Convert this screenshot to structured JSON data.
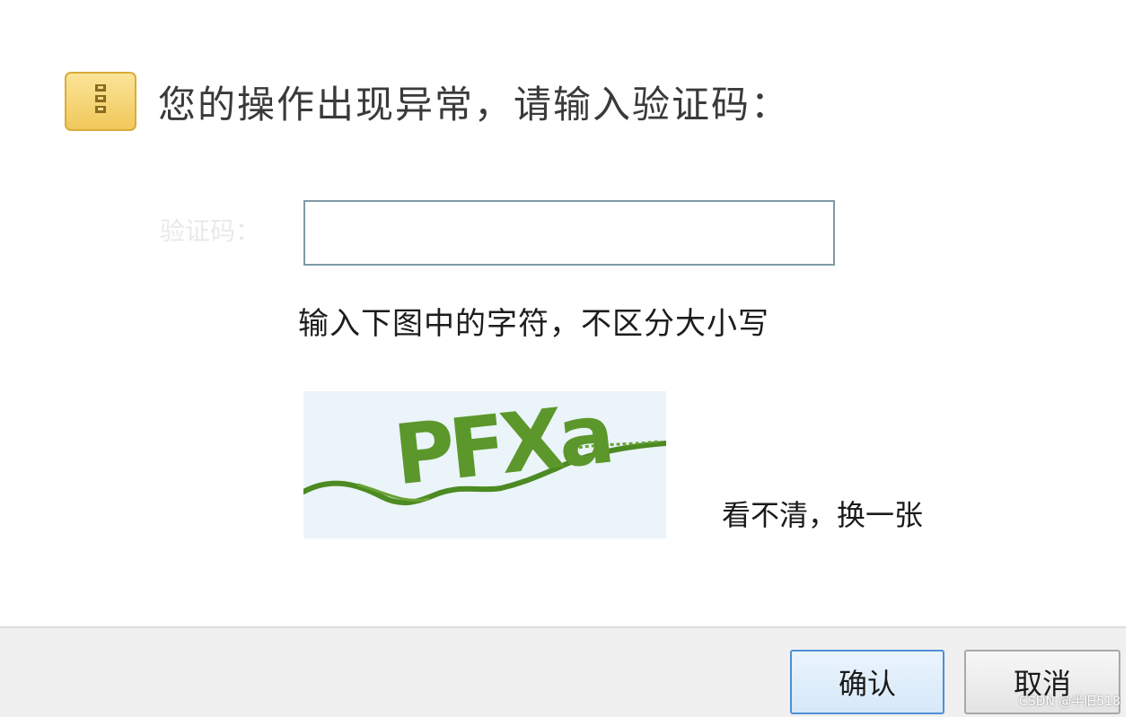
{
  "header": {
    "icon": "archive-icon",
    "title": "您的操作出现异常，请输入验证码："
  },
  "form": {
    "code_label": "验证码：",
    "input_value": "",
    "input_placeholder": "",
    "hint": "输入下图中的字符，不区分大小写"
  },
  "captcha": {
    "text": "PFXa",
    "refresh_label": "看不清，换一张"
  },
  "buttons": {
    "ok_label": "确认",
    "cancel_label": "取消"
  },
  "watermark": "CSDN @半旧518",
  "colors": {
    "captcha_green": "#5c972b",
    "captcha_bg": "#eaf4f9",
    "icon_yellow": "#f2cf6a",
    "ok_border": "#4f8fd6"
  }
}
